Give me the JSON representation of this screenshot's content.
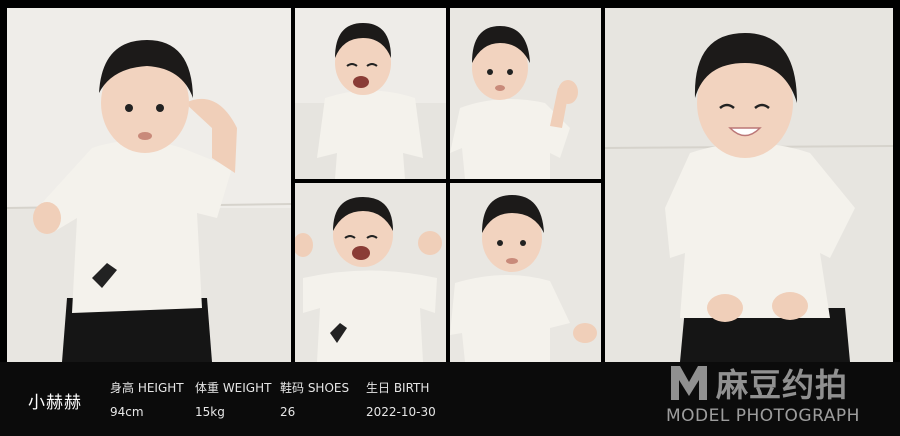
{
  "profile": {
    "name": "小赫赫",
    "stats": [
      {
        "label": "身高 HEIGHT",
        "value": "94cm"
      },
      {
        "label": "体重 WEIGHT",
        "value": "15kg"
      },
      {
        "label": "鞋码 SHOES",
        "value": "26"
      },
      {
        "label": "生日 BIRTH",
        "value": "2022-10-30"
      }
    ]
  },
  "watermark": {
    "brand_cn": "麻豆约拍",
    "brand_en": "MODEL PHOTOGRAPH",
    "logo_letter": "M"
  },
  "colors": {
    "background": "#000000",
    "wall": "#e9e7e2",
    "shirt": "#f3f1ea",
    "hair": "#1c1a19",
    "skin": "#f2d3bf",
    "pants": "#151515"
  }
}
